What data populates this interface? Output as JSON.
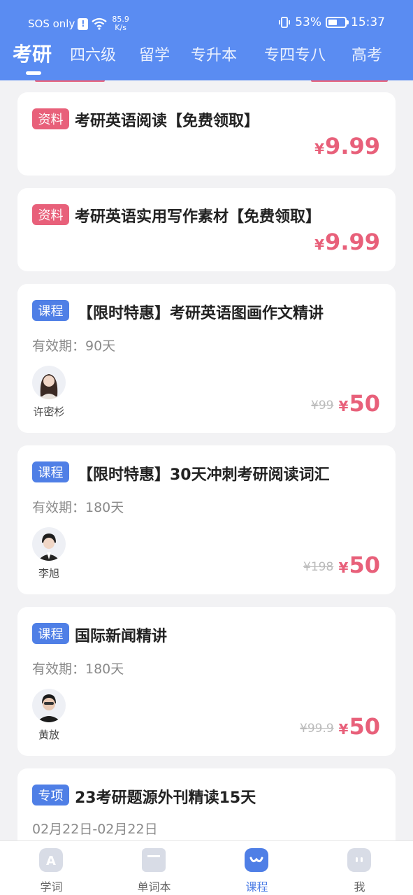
{
  "status_bar": {
    "carrier": "SOS only",
    "sos_mark": "!",
    "net_speed_value": "85.9",
    "net_speed_unit": "K/s",
    "battery": "53%",
    "time": "15:37"
  },
  "tabs": [
    {
      "label": "考研",
      "active": true
    },
    {
      "label": "四六级",
      "active": false
    },
    {
      "label": "留学",
      "active": false
    },
    {
      "label": "专升本",
      "active": false
    },
    {
      "label": "专四专八",
      "active": false
    },
    {
      "label": "高考",
      "active": false
    }
  ],
  "products": [
    {
      "tag": "资料",
      "tag_color": "#e8607a",
      "title": "考研英语阅读【免费领取】",
      "currency": "¥",
      "price": "9.99"
    },
    {
      "tag": "资料",
      "tag_color": "#e8607a",
      "title": "考研英语实用写作素材【免费领取】",
      "currency": "¥",
      "price": "9.99"
    },
    {
      "tag": "课程",
      "tag_color": "#4f7fe6",
      "title": "【限时特惠】考研英语图画作文精讲",
      "validity": "有效期：90天",
      "teacher": "许密杉",
      "original_price": "¥99",
      "currency": "¥",
      "price": "50"
    },
    {
      "tag": "课程",
      "tag_color": "#4f7fe6",
      "title": "【限时特惠】30天冲刺考研阅读词汇",
      "validity": "有效期：180天",
      "teacher": "李旭",
      "original_price": "¥198",
      "currency": "¥",
      "price": "50"
    },
    {
      "tag": "课程",
      "tag_color": "#4f7fe6",
      "title": "国际新闻精讲",
      "validity": "有效期：180天",
      "teacher": "黄放",
      "original_price": "¥99.9",
      "currency": "¥",
      "price": "50"
    },
    {
      "tag": "专项",
      "tag_color": "#4f7fe6",
      "title": "23考研题源外刊精读15天",
      "validity": "02月22日-02月22日"
    }
  ],
  "bottom_nav": [
    {
      "label": "学词",
      "icon": "study-words-icon",
      "active": false
    },
    {
      "label": "单词本",
      "icon": "wordbook-icon",
      "active": false
    },
    {
      "label": "课程",
      "icon": "courses-icon",
      "active": true
    },
    {
      "label": "我",
      "icon": "profile-icon",
      "active": false
    }
  ],
  "colors": {
    "brand_blue": "#5a8cf2",
    "price_red": "#e8607a",
    "tag_blue": "#4f7fe6"
  }
}
